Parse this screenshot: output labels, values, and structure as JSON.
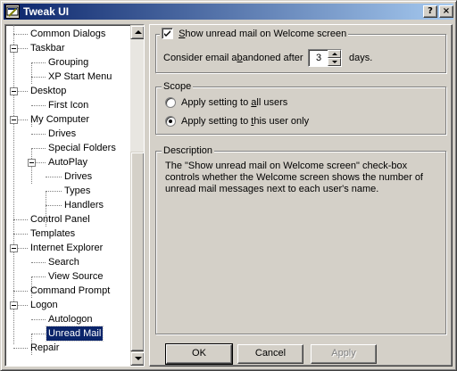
{
  "window": {
    "title": "Tweak UI",
    "help_button": "?",
    "close_button": "×"
  },
  "tree": {
    "items": [
      {
        "label": "Common Dialogs"
      },
      {
        "label": "Taskbar"
      },
      {
        "label": "Grouping"
      },
      {
        "label": "XP Start Menu"
      },
      {
        "label": "Desktop"
      },
      {
        "label": "First Icon"
      },
      {
        "label": "My Computer"
      },
      {
        "label": "Drives"
      },
      {
        "label": "Special Folders"
      },
      {
        "label": "AutoPlay"
      },
      {
        "label": "Drives"
      },
      {
        "label": "Types"
      },
      {
        "label": "Handlers"
      },
      {
        "label": "Control Panel"
      },
      {
        "label": "Templates"
      },
      {
        "label": "Internet Explorer"
      },
      {
        "label": "Search"
      },
      {
        "label": "View Source"
      },
      {
        "label": "Command Prompt"
      },
      {
        "label": "Logon"
      },
      {
        "label": "Autologon"
      },
      {
        "label": "Unread Mail"
      },
      {
        "label": "Repair"
      }
    ],
    "selected": "Unread Mail"
  },
  "settings": {
    "show_unread_pre": "",
    "show_unread_access": "S",
    "show_unread_post": "how unread mail on Welcome screen",
    "show_unread_checked": true,
    "abandon_pre": "Consider email a",
    "abandon_access": "b",
    "abandon_post": "andoned after",
    "abandon_value": "3",
    "abandon_unit": "days."
  },
  "scope": {
    "title": "Scope",
    "all_users_pre": "Apply setting to ",
    "all_users_access": "a",
    "all_users_post": "ll users",
    "this_user_pre": "Apply setting to ",
    "this_user_access": "t",
    "this_user_post": "his user only",
    "selected": "this_user"
  },
  "description": {
    "title": "Description",
    "text": "The \"Show unread mail on Welcome screen\" check-box controls whether the Welcome screen shows the number of unread mail messages next to each user's name."
  },
  "buttons": {
    "ok": "OK",
    "cancel": "Cancel",
    "apply": "Apply"
  }
}
